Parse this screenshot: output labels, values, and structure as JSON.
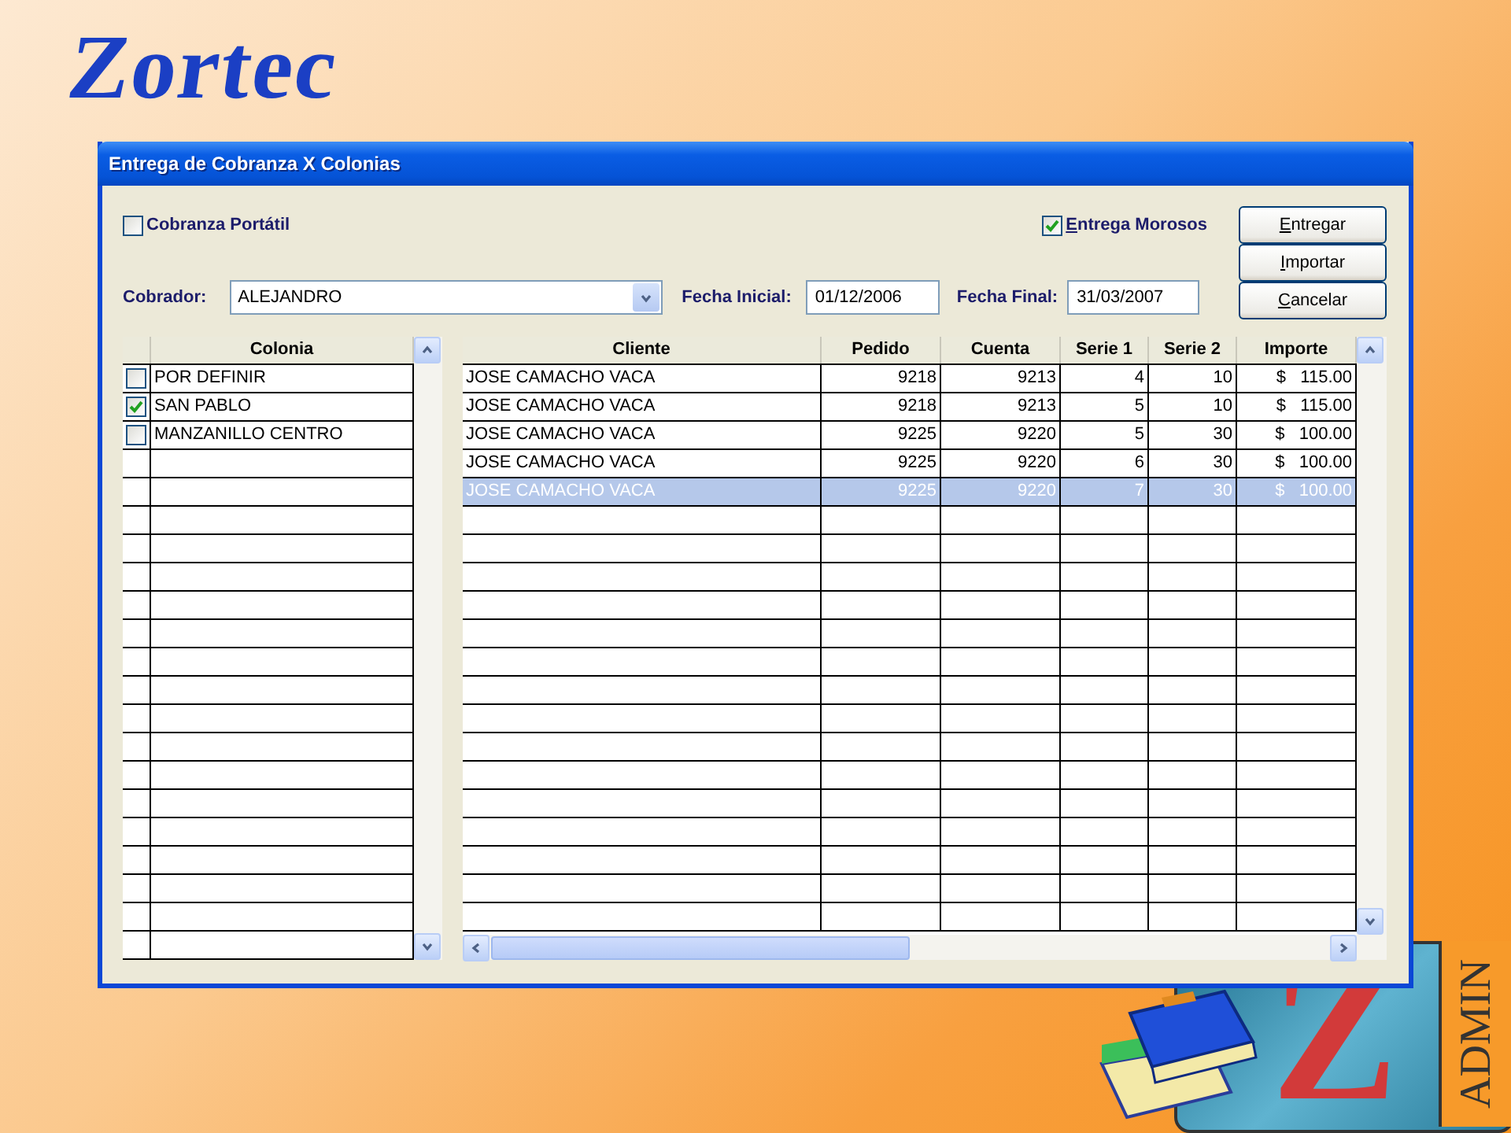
{
  "logo": {
    "text": "Zortec"
  },
  "window": {
    "title": "Entrega de Cobranza X Colonias"
  },
  "options": [
    {
      "label": "Cobranza Portátil",
      "checked": false,
      "underlined_initial": false
    },
    {
      "label": "Entrega Morosos",
      "checked": true,
      "underlined_initial": true
    }
  ],
  "cobrador": {
    "label": "Cobrador:",
    "value": "ALEJANDRO"
  },
  "fecha_inicial": {
    "label": "Fecha Inicial:",
    "value": "01/12/2006"
  },
  "fecha_final": {
    "label": "Fecha Final:",
    "value": "31/03/2007"
  },
  "buttons": [
    {
      "label": "Entregar",
      "underlined_initial": true
    },
    {
      "label": "Importar",
      "underlined_initial": true
    },
    {
      "label": "Cancelar",
      "underlined_initial": true
    }
  ],
  "colonias": {
    "column": "Colonia",
    "rows": [
      {
        "name": "POR DEFINIR",
        "checked": false
      },
      {
        "name": "SAN PABLO",
        "checked": true
      },
      {
        "name": "MANZANILLO CENTRO",
        "checked": false
      }
    ]
  },
  "pedidos": {
    "columns": [
      "Cliente",
      "Pedido",
      "Cuenta",
      "Serie 1",
      "Serie 2",
      "Importe"
    ],
    "rows": [
      {
        "cells": [
          "JOSE CAMACHO VACA",
          "9218",
          "9213",
          "4",
          "10",
          "$   115.00"
        ],
        "selected": false
      },
      {
        "cells": [
          "JOSE CAMACHO VACA",
          "9218",
          "9213",
          "5",
          "10",
          "$   115.00"
        ],
        "selected": false
      },
      {
        "cells": [
          "JOSE CAMACHO VACA",
          "9225",
          "9220",
          "5",
          "30",
          "$   100.00"
        ],
        "selected": false
      },
      {
        "cells": [
          "JOSE CAMACHO VACA",
          "9225",
          "9220",
          "6",
          "30",
          "$   100.00"
        ],
        "selected": false
      },
      {
        "cells": [
          "JOSE CAMACHO VACA",
          "9225",
          "9220",
          "7",
          "30",
          "$   100.00"
        ],
        "selected": true
      }
    ]
  },
  "badge": {
    "letter": "Z",
    "label": "ADMIN"
  }
}
